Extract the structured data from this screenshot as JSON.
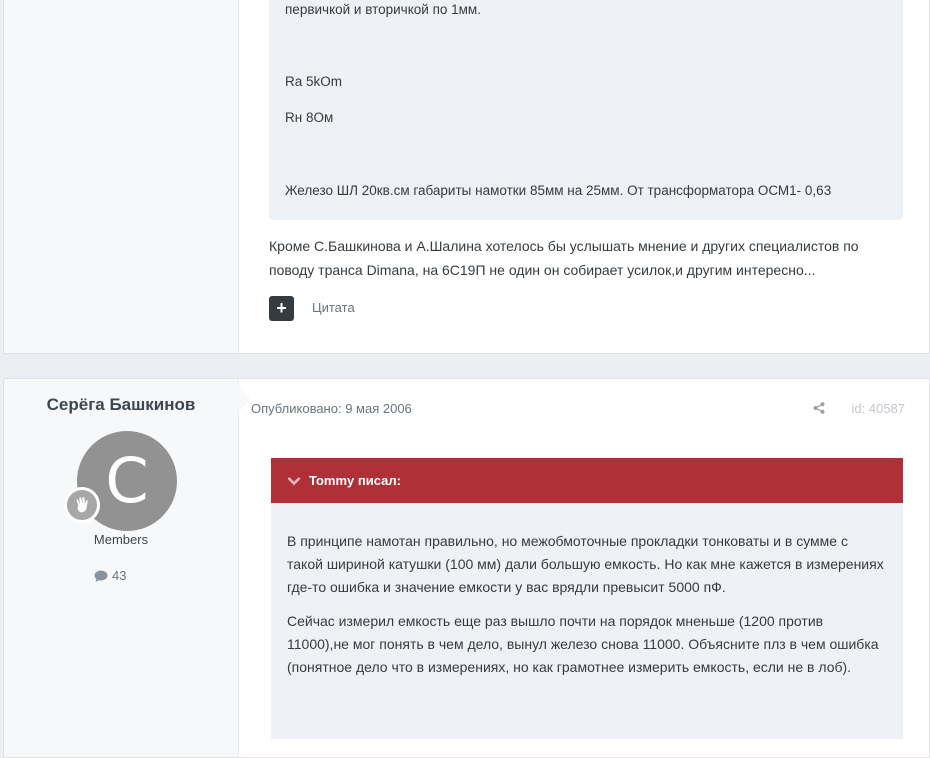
{
  "post1": {
    "quote_lines": [
      "первичкой и вторичкой по 1мм.",
      "Ra 5kOm",
      "Rн 8Ом",
      "Железо ШЛ 20кв.см габариты намотки 85мм на 25мм. От трансформатора ОСМ1- 0,63"
    ],
    "body": "Кроме С.Башкинова и А.Шалина хотелось бы услышать мнение и других специалистов по поводу транса Dimana, на 6С19П не один он собирает усилок,и другим интересно...",
    "multiquote_icon": "plus-icon",
    "quote_label": "Цитата"
  },
  "post2": {
    "author": "Серёга Башкинов",
    "avatar_letter": "C",
    "avatar_color": "#929292",
    "group": "Members",
    "post_count": "43",
    "date": "Опубликовано: 9 мая 2006",
    "post_id": "id: 40587",
    "quote_author": "Tommy писал:",
    "quote_color": "#b03038",
    "quote_paragraphs": [
      "В принципе намотан правильно, но межобмоточные прокладки тонковаты и в сумме с такой шириной катушки (100 мм) дали большую емкость. Но как мне кажется в измерениях где-то ошибка и значение емкости у вас врядли превысит 5000 пФ.",
      "Сейчас измерил емкость еще раз вышло почти на порядок мненьше (1200 против 11000),не мог понять в чем дело, вынул железо снова 11000. Объясните плз в чем ошибка (понятное дело что в измерениях, но как грамотнее измерить емкость, если не в лоб)."
    ]
  }
}
